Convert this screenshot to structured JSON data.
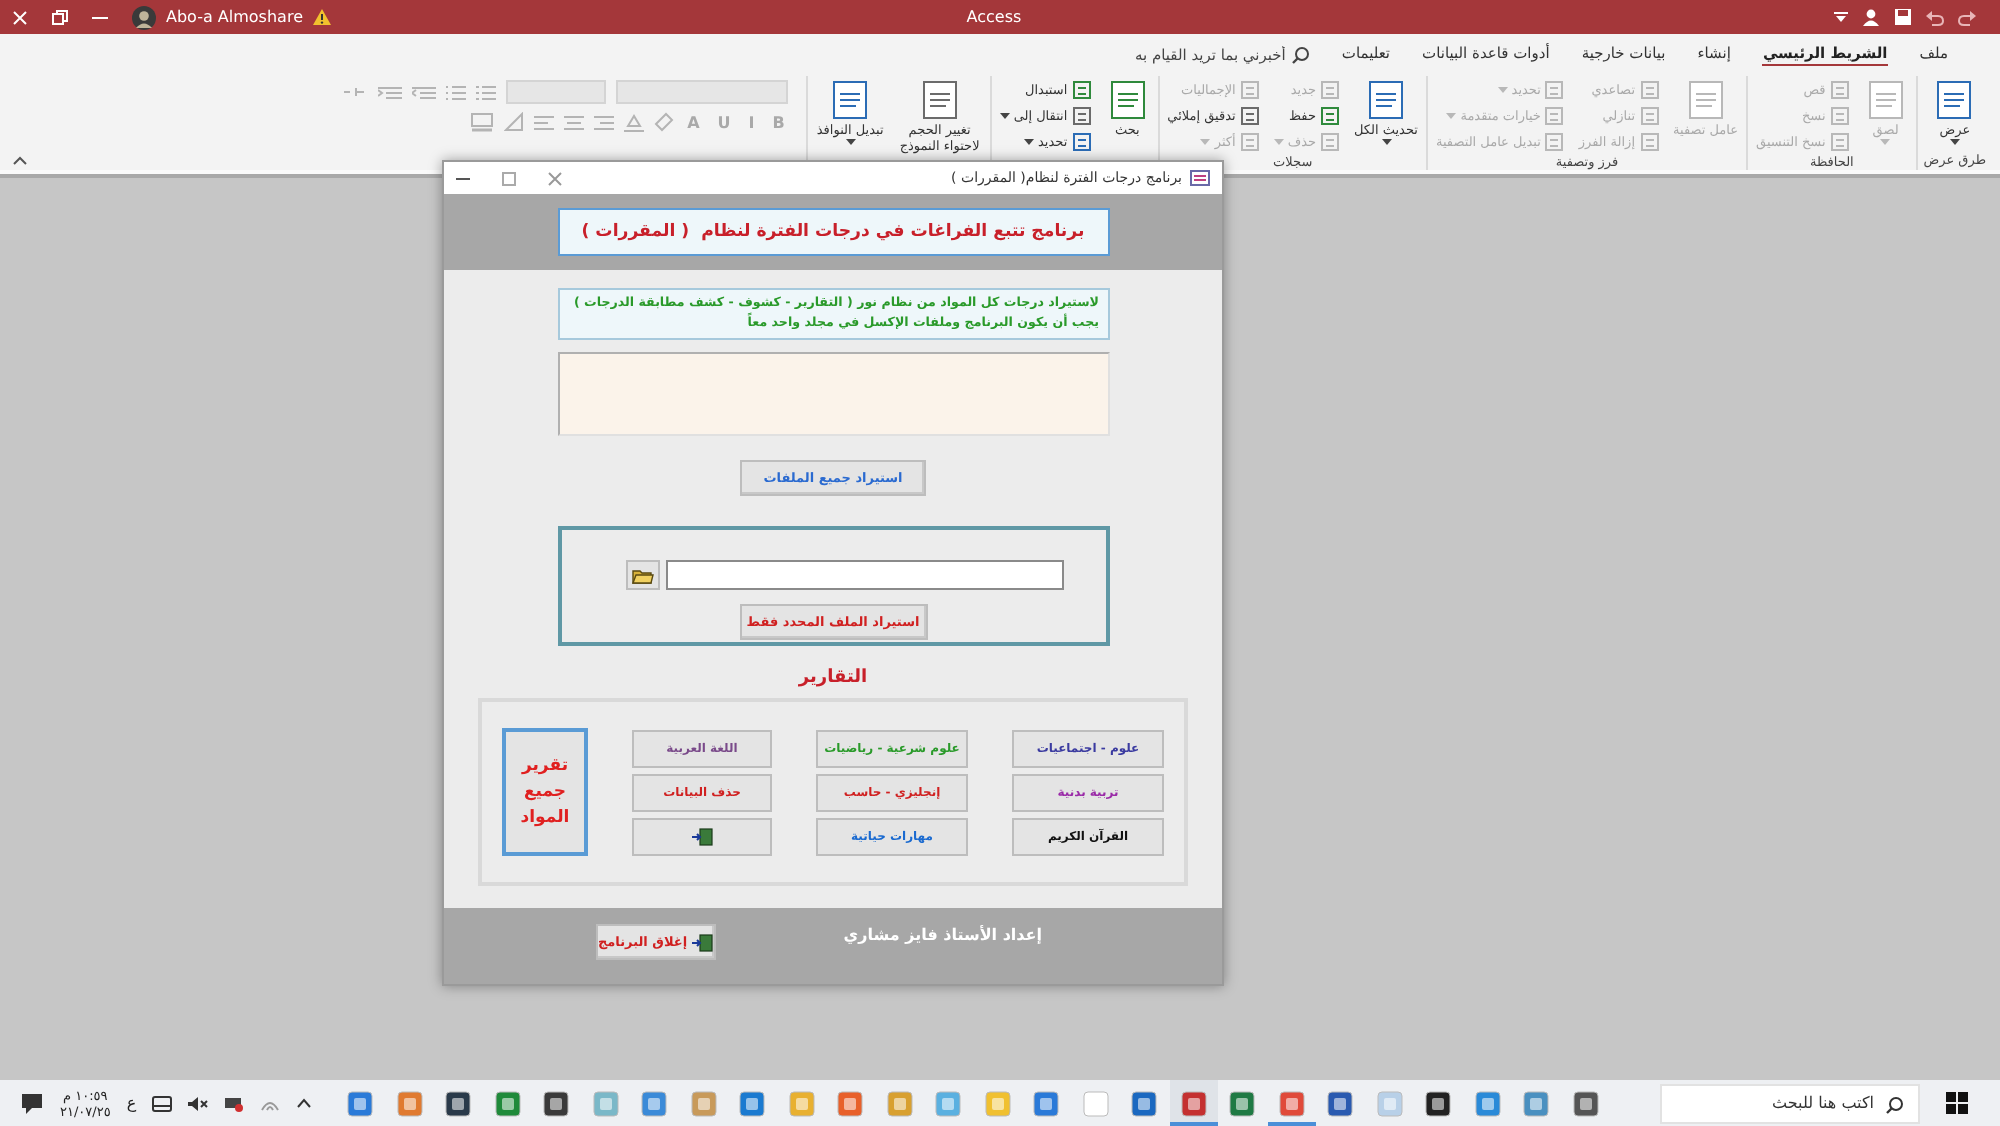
{
  "app_window": {
    "title": "Access",
    "user": "Abo-a Almoshare"
  },
  "ribbon_tabs": [
    {
      "label": "ملف",
      "selected": false
    },
    {
      "label": "الشريط الرئيسي",
      "selected": true
    },
    {
      "label": "إنشاء",
      "selected": false
    },
    {
      "label": "بيانات خارجية",
      "selected": false
    },
    {
      "label": "أدوات قاعدة البيانات",
      "selected": false
    },
    {
      "label": "تعليمات",
      "selected": false
    }
  ],
  "tell_me": {
    "placeholder": "أخبرني بما تريد القيام به"
  },
  "ribbon_groups": [
    {
      "label": "طرق عرض",
      "large": [
        {
          "label": "عرض",
          "disabled": false,
          "dropdown": true
        }
      ]
    },
    {
      "label": "الحافظة",
      "large": [
        {
          "label": "لصق",
          "disabled": true,
          "dropdown": true
        }
      ],
      "columns": [
        [
          {
            "label": "قص",
            "disabled": true
          },
          {
            "label": "نسخ",
            "disabled": true
          },
          {
            "label": "نسخ التنسيق",
            "disabled": true
          }
        ]
      ]
    },
    {
      "label": "فرز وتصفية",
      "large": [
        {
          "label": "عامل تصفية",
          "disabled": true
        }
      ],
      "columns": [
        [
          {
            "label": "تصاعدي",
            "disabled": true
          },
          {
            "label": "تنازلي",
            "disabled": true
          },
          {
            "label": "إزالة الفرز",
            "disabled": true
          }
        ],
        [
          {
            "label": "تحديد",
            "disabled": true,
            "dropdown": true
          },
          {
            "label": "خيارات متقدمة",
            "disabled": true,
            "dropdown": true
          },
          {
            "label": "تبديل عامل التصفية",
            "disabled": true
          }
        ]
      ]
    },
    {
      "label": "سجلات",
      "large": [
        {
          "label": "تحديث الكل",
          "disabled": false,
          "dropdown": true
        }
      ],
      "columns": [
        [
          {
            "label": "جديد",
            "disabled": true
          },
          {
            "label": "حفظ",
            "disabled": false
          },
          {
            "label": "حذف",
            "disabled": true,
            "dropdown": true
          }
        ],
        [
          {
            "label": "الإجماليات",
            "disabled": true
          },
          {
            "label": "تدقيق إملائي",
            "disabled": false
          },
          {
            "label": "أكثر",
            "disabled": true,
            "dropdown": true
          }
        ]
      ]
    },
    {
      "large": [
        {
          "label": "بحث",
          "disabled": false
        }
      ],
      "columns": [
        [
          {
            "label": "استبدال",
            "disabled": false
          },
          {
            "label": "انتقال إلى",
            "disabled": false,
            "dropdown": true
          },
          {
            "label": "تحديد",
            "disabled": false,
            "dropdown": true
          }
        ]
      ]
    },
    {
      "large": [
        {
          "label": "تغيير الحجم لاحتواء النموذج",
          "disabled": false
        },
        {
          "label": "تبديل النوافذ",
          "disabled": false,
          "dropdown": true
        }
      ]
    }
  ],
  "text_format": {
    "disabled": true,
    "buttons": [
      "B",
      "I",
      "U",
      "A"
    ]
  },
  "dialog": {
    "title": "برنامج درجات الفترة لنظام( المقررات )",
    "heading": "برنامج تتبع الفراغات في درجات الفترة لنظام  ( المقررات )",
    "note": "لاستيراد درجات كل المواد من نظام نور ( التقارير - كشوف - كشف مطابقة الدرجات ) يجب أن يكون البرنامج وملفات الإكسل في مجلد واحد معاً",
    "import_all_button": "استيراد جميع الملفات",
    "import_selected_button": "استيراد الملف المحدد فقط",
    "reports_heading": "التقارير",
    "reports": [
      {
        "kind": "text",
        "label": "علوم - اجتماعيات",
        "color": "#3b3ba0"
      },
      {
        "kind": "text",
        "label": "علوم شرعية  - رياضيات",
        "color": "#2a9a2a"
      },
      {
        "kind": "text",
        "label": "اللغة العربية",
        "color": "#7a4a8a"
      },
      {
        "kind": "text",
        "label": "تربية بدنية",
        "color": "#9a2aa8"
      },
      {
        "kind": "text",
        "label": "إنجليزي - حاسب",
        "color": "#d02020"
      },
      {
        "kind": "text",
        "label": "حذف البيانات",
        "color": "#d02020"
      },
      {
        "kind": "text",
        "label": "القرآن الكريم",
        "color": "#111111"
      },
      {
        "kind": "text",
        "label": "مهارات حياتية",
        "color": "#1a6ad0"
      },
      {
        "kind": "icon"
      }
    ],
    "all_reports_button": "تقرير جميع المواد",
    "credit": "إعداد الأستاذ فايز مشاري",
    "close_button": "إغلاق البرنامج"
  },
  "taskbar": {
    "time": "١٠:٥٩ م",
    "date": "٢١/٠٧/٢٥",
    "language": "ع",
    "apps": [
      {
        "running": false,
        "selected": false
      },
      {
        "running": false,
        "selected": false
      },
      {
        "running": false,
        "selected": false
      },
      {
        "running": false,
        "selected": false
      },
      {
        "running": false,
        "selected": false
      },
      {
        "running": false,
        "selected": false
      },
      {
        "running": false,
        "selected": false
      },
      {
        "running": false,
        "selected": false
      },
      {
        "running": false,
        "selected": false
      },
      {
        "running": false,
        "selected": false
      },
      {
        "running": false,
        "selected": false
      },
      {
        "running": false,
        "selected": false
      },
      {
        "running": false,
        "selected": false
      },
      {
        "running": false,
        "selected": false
      },
      {
        "running": false,
        "selected": false
      },
      {
        "running": false,
        "selected": false
      },
      {
        "running": false,
        "selected": false
      },
      {
        "running": true,
        "selected": true
      },
      {
        "running": false,
        "selected": false
      },
      {
        "running": true,
        "selected": false
      },
      {
        "running": false,
        "selected": false
      },
      {
        "running": false,
        "selected": false
      },
      {
        "running": false,
        "selected": false
      },
      {
        "running": false,
        "selected": false
      },
      {
        "running": false,
        "selected": false
      },
      {
        "running": false,
        "selected": false
      }
    ],
    "search": {
      "placeholder": "اكتب هنا للبحث"
    }
  }
}
